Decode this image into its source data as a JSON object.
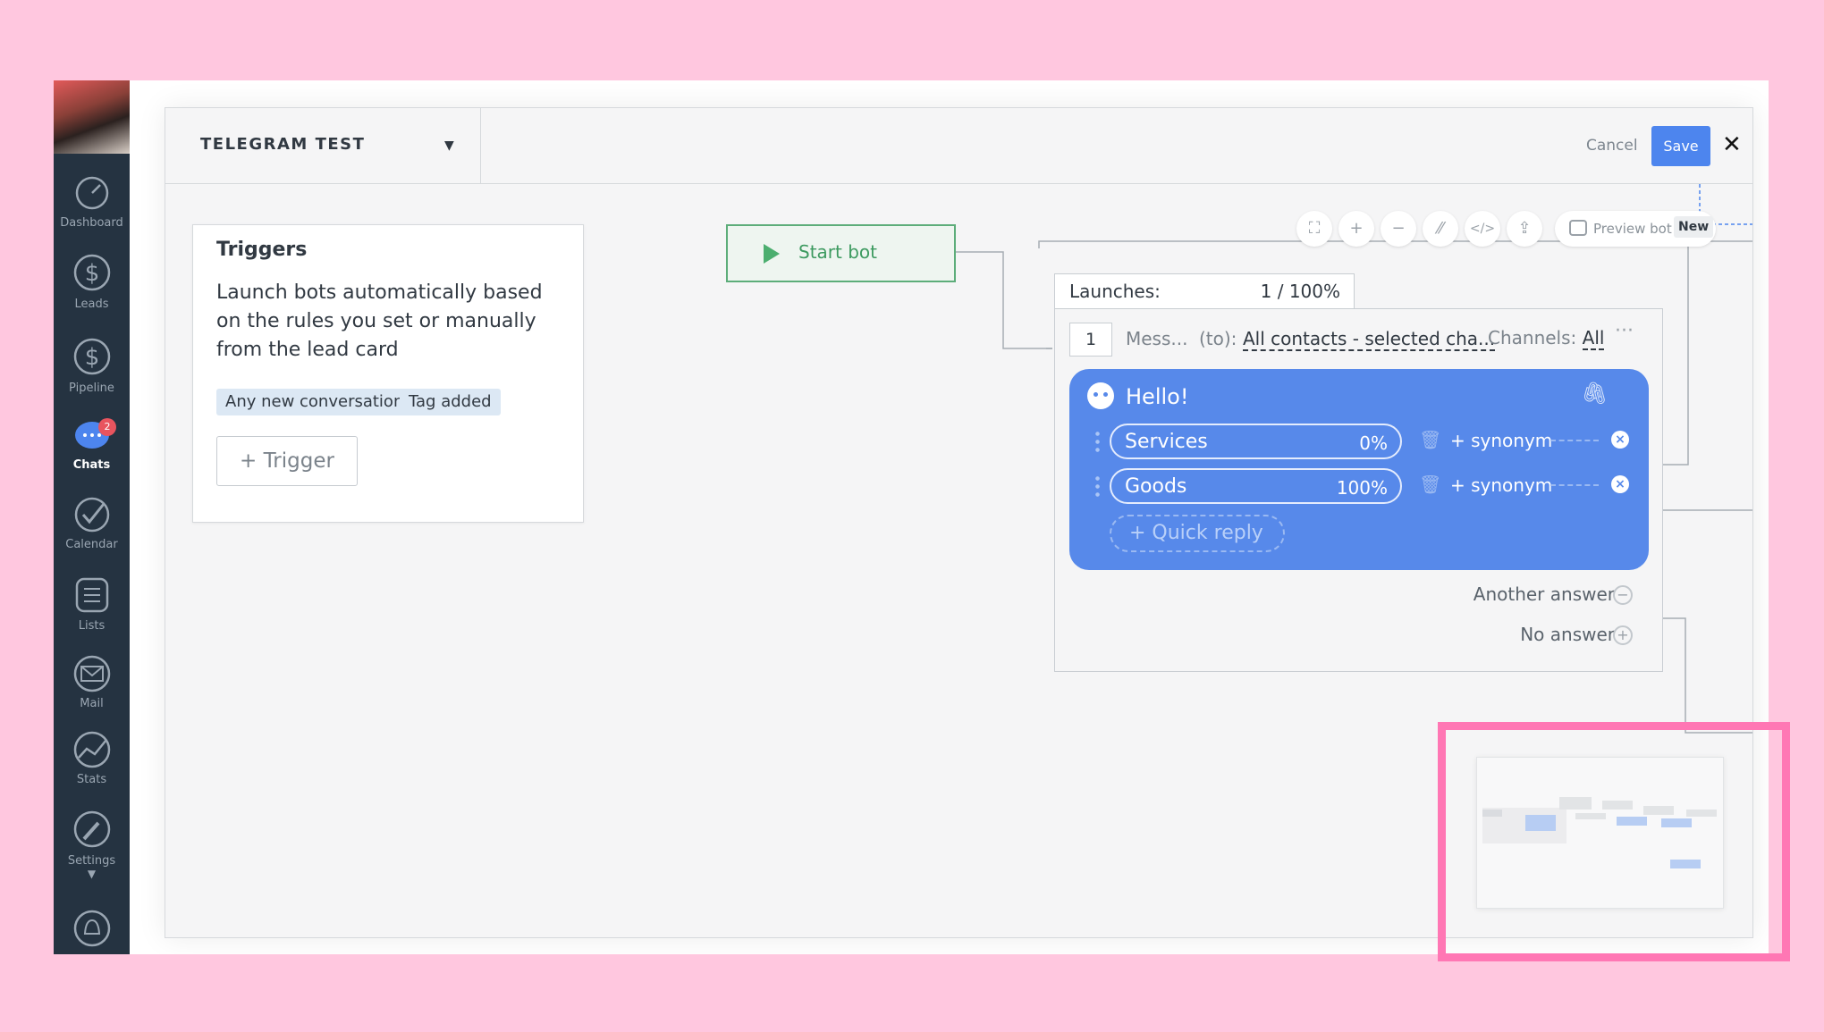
{
  "nav": {
    "items": [
      {
        "label": "Dashboard",
        "icon": "dashboard-icon"
      },
      {
        "label": "Leads",
        "icon": "dollar-icon"
      },
      {
        "label": "Pipeline",
        "icon": "dollar-icon"
      },
      {
        "label": "Chats",
        "icon": "chat-icon",
        "badge": "2",
        "active": true
      },
      {
        "label": "Calendar",
        "icon": "check-circle-icon"
      },
      {
        "label": "Lists",
        "icon": "list-icon"
      },
      {
        "label": "Mail",
        "icon": "mail-icon"
      },
      {
        "label": "Stats",
        "icon": "stats-icon"
      },
      {
        "label": "Settings",
        "icon": "wrench-icon"
      }
    ]
  },
  "header": {
    "title": "TELEGRAM TEST",
    "cancel_label": "Cancel",
    "save_label": "Save",
    "close_glyph": "✕"
  },
  "triggers": {
    "heading": "Triggers",
    "description": "Launch bots automatically based on the rules you set or manually from the lead card",
    "tags": [
      "Any new conversation",
      "Tag added"
    ],
    "add_label": "+ Trigger"
  },
  "start_bot": {
    "label": "Start bot"
  },
  "toolbar": {
    "preview_label": "Preview bot",
    "new_badge": "New"
  },
  "launches": {
    "label": "Launches:",
    "value": "1 / 100%"
  },
  "step": {
    "number": "1",
    "message_label": "Mess...",
    "to_label": "(to):",
    "contacts": "All contacts - selected cha...",
    "channels_label": "Channels:",
    "channels_value": "All",
    "more": "···",
    "greeting": "Hello!",
    "quick_replies": [
      {
        "label": "Services",
        "percent": "0%",
        "synonym": "+ synonym"
      },
      {
        "label": "Goods",
        "percent": "100%",
        "synonym": "+ synonym"
      }
    ],
    "add_quick_reply": "+ Quick reply",
    "another_answer": "Another answer",
    "no_answer": "No answer"
  },
  "colors": {
    "accent": "#4d85ee",
    "bubble": "#5789ea",
    "start_green": "#4cae6f",
    "sidebar": "#253341",
    "highlight": "#ff77b4"
  }
}
